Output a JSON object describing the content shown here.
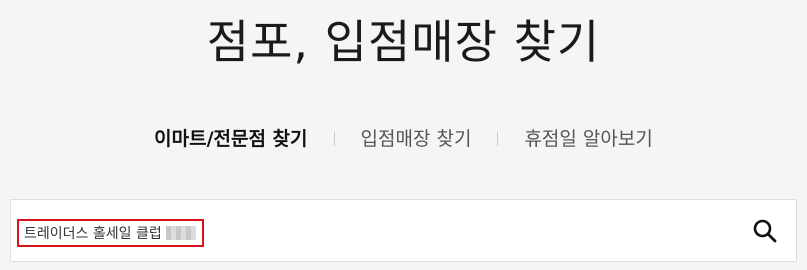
{
  "page": {
    "title": "점포, 입점매장 찾기"
  },
  "tabs": [
    {
      "label": "이마트/전문점 찾기",
      "active": true
    },
    {
      "label": "입점매장 찾기",
      "active": false
    },
    {
      "label": "휴점일 알아보기",
      "active": false
    }
  ],
  "search": {
    "value": "트레이더스 홀세일 클럽",
    "icon": "search-icon"
  },
  "colors": {
    "background": "#f5f5f5",
    "highlight_border": "#d9121d",
    "active_tab": "#111111",
    "inactive_tab": "#555555"
  }
}
